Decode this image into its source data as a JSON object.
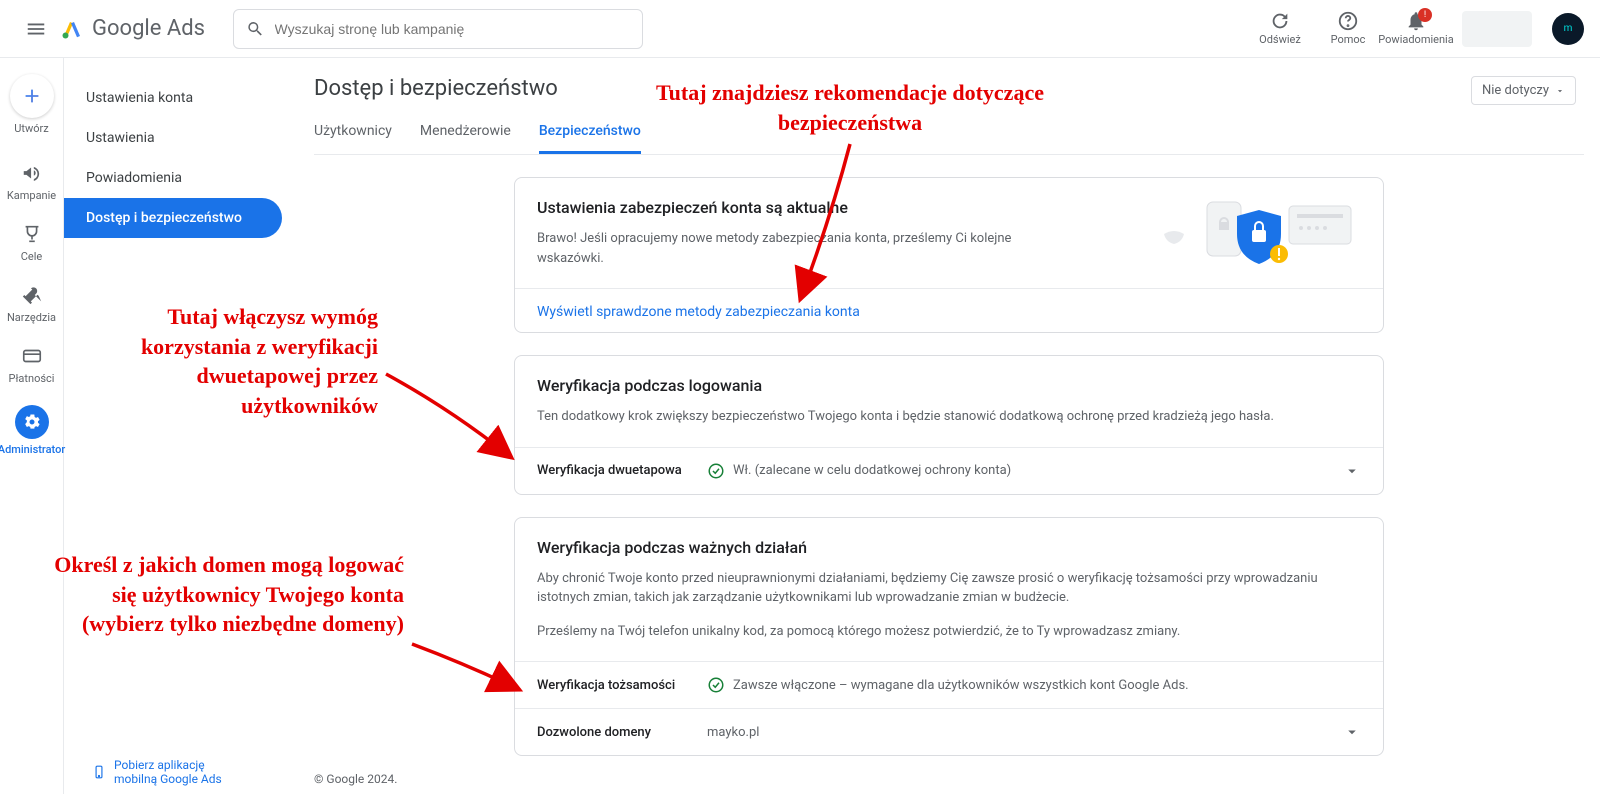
{
  "header": {
    "logo_text": "Google Ads",
    "search_placeholder": "Wyszukaj stronę lub kampanię",
    "refresh": "Odśwież",
    "help": "Pomoc",
    "notifications": "Powiadomienia",
    "notif_badge": "!"
  },
  "rail": {
    "create": "Utwórz",
    "items": [
      {
        "label": "Kampanie"
      },
      {
        "label": "Cele"
      },
      {
        "label": "Narzędzia"
      },
      {
        "label": "Płatności"
      },
      {
        "label": "Administrator"
      }
    ]
  },
  "side": {
    "items": [
      {
        "label": "Ustawienia konta"
      },
      {
        "label": "Ustawienia"
      },
      {
        "label": "Powiadomienia"
      },
      {
        "label": "Dostęp i bezpieczeństwo"
      }
    ]
  },
  "page": {
    "title": "Dostęp i bezpieczeństwo",
    "scope_dd": "Nie dotyczy",
    "tabs": [
      {
        "label": "Użytkownicy"
      },
      {
        "label": "Menedżerowie"
      },
      {
        "label": "Bezpieczeństwo"
      }
    ]
  },
  "cards": {
    "status": {
      "title": "Ustawienia zabezpieczeń konta są aktualne",
      "desc": "Brawo! Jeśli opracujemy nowe metody zabezpieczania konta, prześlemy Ci kolejne wskazówki.",
      "link": "Wyświetl sprawdzone metody zabezpieczania konta"
    },
    "login_verif": {
      "title": "Weryfikacja podczas logowania",
      "desc": "Ten dodatkowy krok zwiększy bezpieczeństwo Twojego konta i będzie stanowić dodatkową ochronę przed kradzieżą jego hasła.",
      "row_label": "Weryfikacja dwuetapowa",
      "row_status": "Wł. (zalecane w celu dodatkowej ochrony konta)"
    },
    "action_verif": {
      "title": "Weryfikacja podczas ważnych działań",
      "desc": "Aby chronić Twoje konto przed nieuprawnionymi działaniami, będziemy Cię zawsze prosić o weryfikację tożsamości przy wprowadzaniu istotnych zmian, takich jak zarządzanie użytkownikami lub wprowadzanie zmian w budżecie.",
      "desc2": "Prześlemy na Twój telefon unikalny kod, za pomocą którego możesz potwierdzić, że to Ty wprowadzasz zmiany.",
      "row1_label": "Weryfikacja tożsamości",
      "row1_status": "Zawsze włączone – wymagane dla użytkowników wszystkich kont Google Ads.",
      "row2_label": "Dozwolone domeny",
      "row2_status": "mayko.pl"
    }
  },
  "footer": {
    "mobile": "Pobierz aplikację mobilną Google Ads",
    "copy": "© Google 2024."
  },
  "annotations": {
    "a1": "Tutaj znajdziesz rekomendacje dotyczące bezpieczeństwa",
    "a2": "Tutaj włączysz wymóg korzystania z weryfikacji dwuetapowej przez użytkowników",
    "a3": "Określ z jakich domen mogą logować się użytkownicy Twojego konta (wybierz tylko niezbędne domeny)"
  }
}
